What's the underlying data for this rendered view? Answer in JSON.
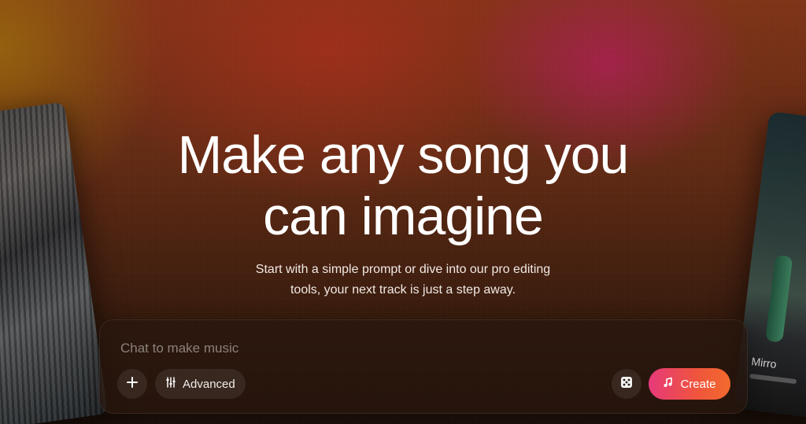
{
  "hero": {
    "title_line1": "Make any song you",
    "title_line2": "can imagine",
    "subtitle_line1": "Start with a simple prompt or dive into our pro editing",
    "subtitle_line2": "tools, your next track is just a step away."
  },
  "composer": {
    "placeholder": "Chat to make music",
    "value": "",
    "advanced_label": "Advanced",
    "create_label": "Create"
  },
  "side_cards": {
    "right_caption": "Mirro"
  },
  "icons": {
    "plus": "plus-icon",
    "advanced": "sliders-icon",
    "dice": "dice-icon",
    "create": "music-note-icon"
  },
  "colors": {
    "create_gradient_start": "#e6397a",
    "create_gradient_end": "#f26a2d"
  }
}
